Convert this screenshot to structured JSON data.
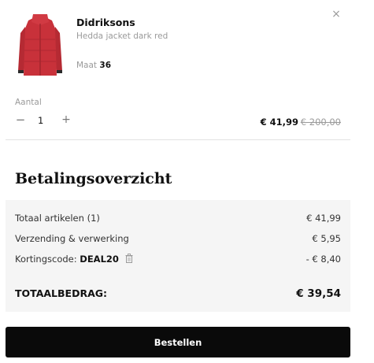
{
  "product": {
    "brand": "Didriksons",
    "name": "Hedda jacket dark red",
    "size_label": "Maat",
    "size_value": "36",
    "image_icon": "red-jacket-image",
    "remove_icon": "close-icon",
    "remove_glyph": "×",
    "quantity": {
      "label": "Aantal",
      "value": "1",
      "minus": "−",
      "plus": "+"
    },
    "price_current": "€ 41,99",
    "price_original": "€ 200,00"
  },
  "summary": {
    "title": "Betalingsoverzicht",
    "rows": [
      {
        "label": "Totaal artikelen (1)",
        "value": "€ 41,99"
      },
      {
        "label": "Verzending & verwerking",
        "value": "€ 5,95"
      },
      {
        "label": "Kortingscode:",
        "code": "DEAL20",
        "value": "- € 8,40"
      }
    ],
    "total_label": "TOTAALBEDRAG:",
    "total_value": "€ 39,54"
  },
  "checkout": {
    "button_label": "Bestellen"
  },
  "colors": {
    "jacket": "#c8313a",
    "button_bg": "#0a0a0a",
    "summary_bg": "#f5f5f5"
  }
}
